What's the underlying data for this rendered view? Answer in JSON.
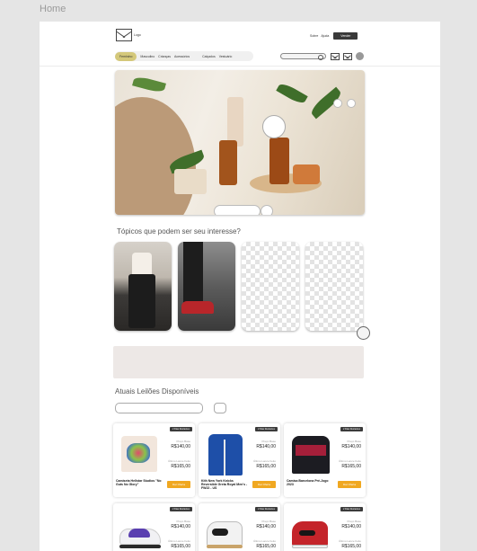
{
  "frame_label": "Home",
  "header": {
    "logo_text": "Logo",
    "links": [
      "Sobre",
      "Ajuda"
    ],
    "cta_label": "Vender",
    "nav": [
      "Feminino",
      "Masculino",
      "Crianças",
      "Acessórios",
      "Calçados",
      "Vestuário"
    ]
  },
  "topics_title": "Tópicos que podem ser seu interesse?",
  "auctions_title": "Atuais Leilões Disponíveis",
  "card_text": {
    "badge": "2 Dias Restantes",
    "price_label": "Preço Base",
    "last_bid_label": "Último Lance Feito",
    "bid_button": "Dar Oferta"
  },
  "products": [
    {
      "name": "Camiseta Hellstar Studios \"No Guts No Glory\"",
      "base_price": "R$140,00",
      "last_bid": "R$165,00"
    },
    {
      "name": "Kith New York Knicks Reversible Greta Royal Men's - FW22 - US",
      "base_price": "R$140,00",
      "last_bid": "R$165,00"
    },
    {
      "name": "Camisa Barcelona Pré-Jogo 2023",
      "base_price": "R$140,00",
      "last_bid": "R$165,00"
    },
    {
      "name": "",
      "base_price": "R$140,00",
      "last_bid": "R$165,00"
    },
    {
      "name": "",
      "base_price": "R$140,00",
      "last_bid": "R$165,00"
    },
    {
      "name": "",
      "base_price": "R$140,00",
      "last_bid": "R$165,00"
    }
  ],
  "colors": {
    "nav_active": "#d4c87a",
    "cta_dark": "#3a3a3a",
    "bid_button": "#f0a821",
    "banner": "#ede8e6"
  }
}
